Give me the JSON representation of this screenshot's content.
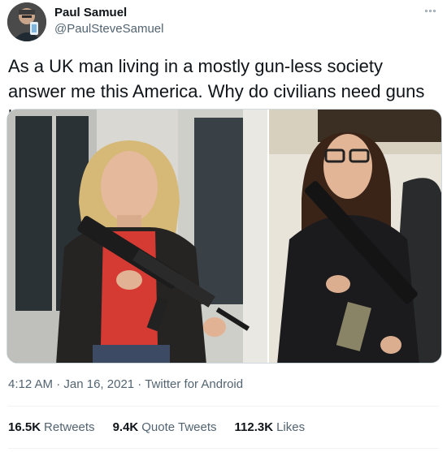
{
  "author": {
    "name": "Paul Samuel",
    "handle": "@PaulSteveSamuel"
  },
  "tweet": {
    "text": "As a UK man living in a mostly gun-less society answer me this America. Why do civilians need guns like this?"
  },
  "meta": {
    "time": "4:12 AM",
    "sep1": " · ",
    "date": "Jan 16, 2021",
    "sep2": " · ",
    "source": "Twitter for Android"
  },
  "stats": {
    "retweets_count": "16.5K",
    "retweets_label": "Retweets",
    "quotes_count": "9.4K",
    "quotes_label": "Quote Tweets",
    "likes_count": "112.3K",
    "likes_label": "Likes"
  },
  "icons": {
    "more": "more-options-icon"
  },
  "colors": {
    "text_primary": "#0f1419",
    "text_secondary": "#536471",
    "border": "#cfd9de"
  }
}
